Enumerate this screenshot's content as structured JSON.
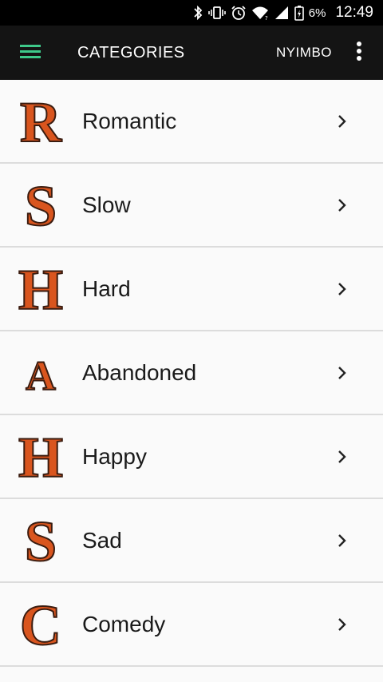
{
  "status_bar": {
    "battery_text": "6%",
    "time": "12:49",
    "icons": [
      "bluetooth-icon",
      "vibrate-icon",
      "alarm-icon",
      "wifi-icon",
      "signal-icon",
      "battery-charging-icon"
    ]
  },
  "app_bar": {
    "title": "CATEGORIES",
    "action_label": "NYIMBO",
    "menu_icon": "hamburger-menu-icon",
    "overflow_icon": "more-vert-icon",
    "accent_color": "#3ec98a"
  },
  "categories": [
    {
      "letter": "R",
      "label": "Romantic"
    },
    {
      "letter": "S",
      "label": "Slow"
    },
    {
      "letter": "H",
      "label": "Hard"
    },
    {
      "letter": "A",
      "label": "Abandoned"
    },
    {
      "letter": "H",
      "label": "Happy"
    },
    {
      "letter": "S",
      "label": "Sad"
    },
    {
      "letter": "C",
      "label": "Comedy"
    }
  ]
}
